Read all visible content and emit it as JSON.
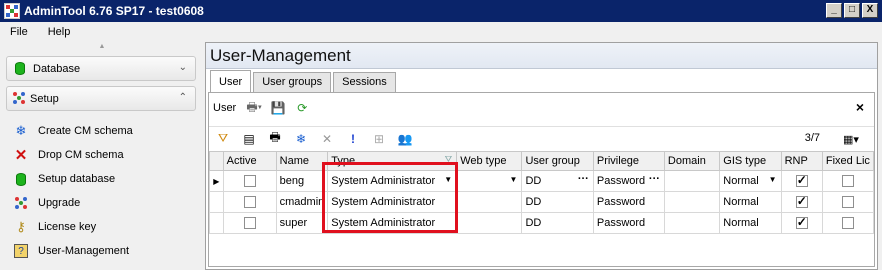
{
  "window": {
    "title": "AdminTool 6.76 SP17 - test0608",
    "controls": [
      "_",
      "□",
      "X"
    ]
  },
  "menu": {
    "items": [
      "File",
      "Help"
    ]
  },
  "nav": {
    "groups": [
      {
        "label": "Database",
        "chevron": "⌄"
      },
      {
        "label": "Setup",
        "chevron": "⌃"
      }
    ],
    "items": [
      {
        "label": "Create CM schema",
        "icon": "snowflake-icon"
      },
      {
        "label": "Drop CM schema",
        "icon": "red-x-icon"
      },
      {
        "label": "Setup database",
        "icon": "database-icon"
      },
      {
        "label": "Upgrade",
        "icon": "dots-icon"
      },
      {
        "label": "License key",
        "icon": "key-icon"
      },
      {
        "label": "User-Management",
        "icon": "user-management-icon"
      }
    ]
  },
  "panel": {
    "title": "User-Management",
    "tabs": [
      "User",
      "User groups",
      "Sessions"
    ],
    "toolbar_label": "User",
    "close": "×",
    "counter": "3/7"
  },
  "grid": {
    "columns": [
      "Active",
      "Name",
      "Type",
      "Web type",
      "User group",
      "Privilege",
      "Domain",
      "GIS type",
      "RNP",
      "Fixed Lic"
    ],
    "rows": [
      {
        "active": false,
        "name": "beng",
        "type": "System Administrator",
        "web_type": "",
        "user_group": "DD",
        "privilege": "Password",
        "domain": "",
        "gis_type": "Normal",
        "rnp": true,
        "fixed": false,
        "current": true
      },
      {
        "active": false,
        "name": "cmadmin",
        "type": "System Administrator",
        "web_type": "",
        "user_group": "DD",
        "privilege": "Password",
        "domain": "",
        "gis_type": "Normal",
        "rnp": true,
        "fixed": false,
        "current": false
      },
      {
        "active": false,
        "name": "super",
        "type": "System Administrator",
        "web_type": "",
        "user_group": "DD",
        "privilege": "Password",
        "domain": "",
        "gis_type": "Normal",
        "rnp": true,
        "fixed": false,
        "current": false
      }
    ]
  },
  "colors": {
    "highlight": "#e0101e",
    "titlebar": "#0a246a"
  }
}
